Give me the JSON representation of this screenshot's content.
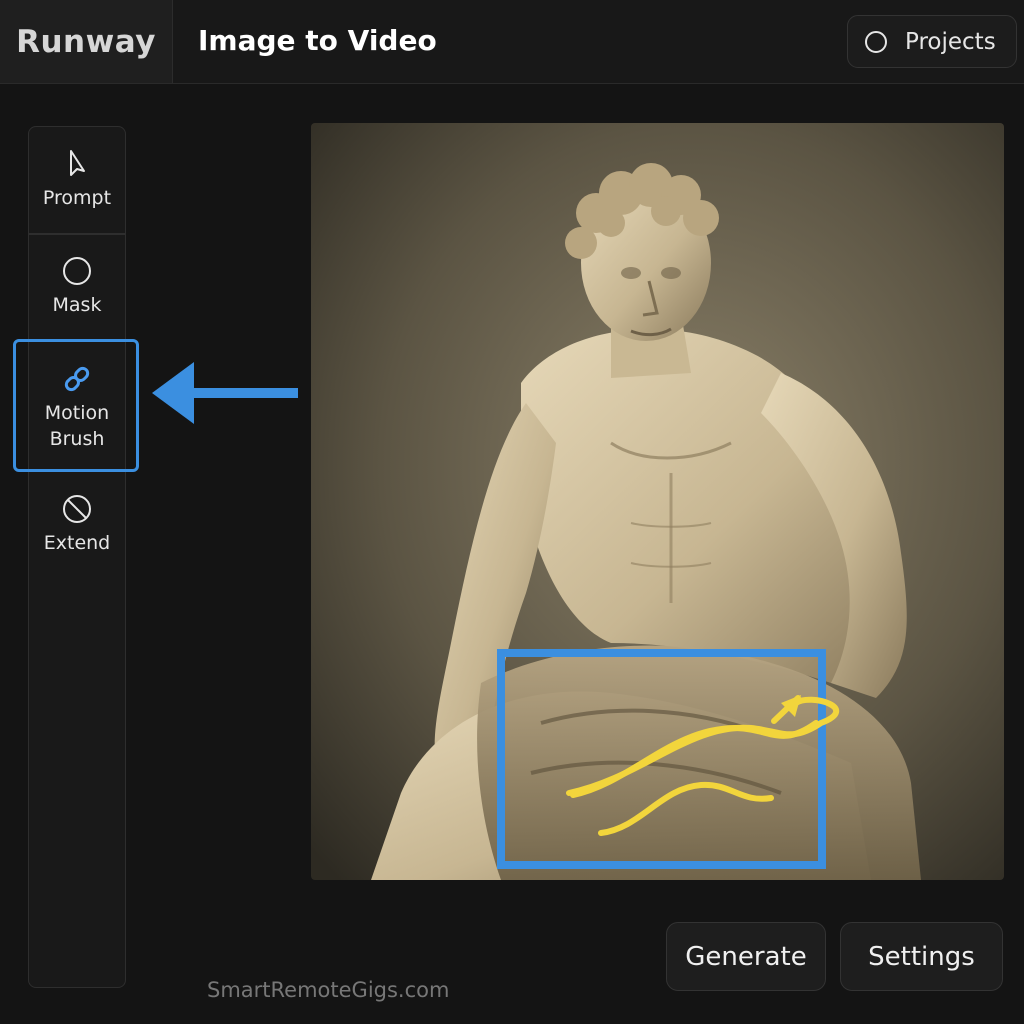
{
  "header": {
    "brand": "Runway",
    "title": "Image to Video",
    "projects_label": "Projects"
  },
  "tools": [
    {
      "icon": "cursor-icon",
      "label": "Prompt"
    },
    {
      "icon": "circle-icon",
      "label": "Mask"
    },
    {
      "icon": "link-icon",
      "label": "Motion Brush",
      "line1": "Motion",
      "line2": "Brush",
      "selected": true
    },
    {
      "icon": "forbidden-icon",
      "label": "Extend"
    }
  ],
  "canvas": {
    "subject": "statue-image"
  },
  "actions": {
    "generate_label": "Generate",
    "settings_label": "Settings"
  },
  "watermark": "SmartRemoteGigs.com",
  "colors": {
    "accent": "#3b8fe0",
    "motion_stroke": "#f2d53c",
    "background": "#141414"
  }
}
